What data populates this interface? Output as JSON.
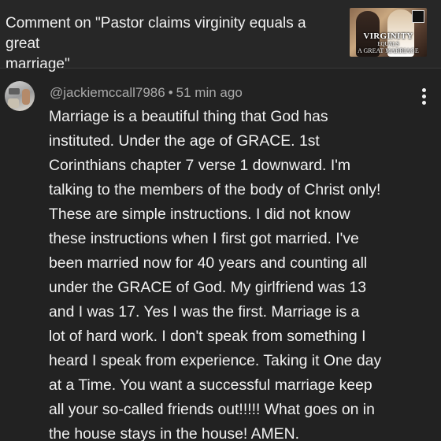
{
  "header": {
    "title_line1": "Comment on \"Pastor claims virginity equals a great",
    "title_line2": "marriage\"",
    "thumbnail": {
      "caption_line1": "VIRGINITY",
      "caption_line2": "EQUALS",
      "caption_line3": "A GREAT MARRIAGE"
    }
  },
  "comment": {
    "author": "@jackiemccall7986",
    "separator": "•",
    "time": "51 min ago",
    "more_icon": "vertical-dots-icon",
    "lines": [
      "Marriage is a beautiful thing that God has",
      "instituted. Under the age of GRACE. 1st",
      "Corinthians chapter 7 verse 1 downward. I'm",
      "talking to the members of the body of Christ only!",
      "These are simple instructions. I did not know",
      "these instructions when I first got married. I've",
      "been married now for 40 years and counting all",
      "under the GRACE of God. My girlfriend was 13",
      "and I was 17. Yes I was the first. Marriage is a",
      "lot of hard work. I don't speak from something I",
      "heard I speak from experience. Taking it One day",
      "at a Time. You want a successful marriage keep",
      "all your so-called friends out!!!!! What goes on in",
      "the house stays in the house! AMEN."
    ]
  },
  "colors": {
    "background": "#222222",
    "header_background": "#272727",
    "text_primary": "#f1f1f1",
    "text_secondary": "#aaaaaa"
  }
}
